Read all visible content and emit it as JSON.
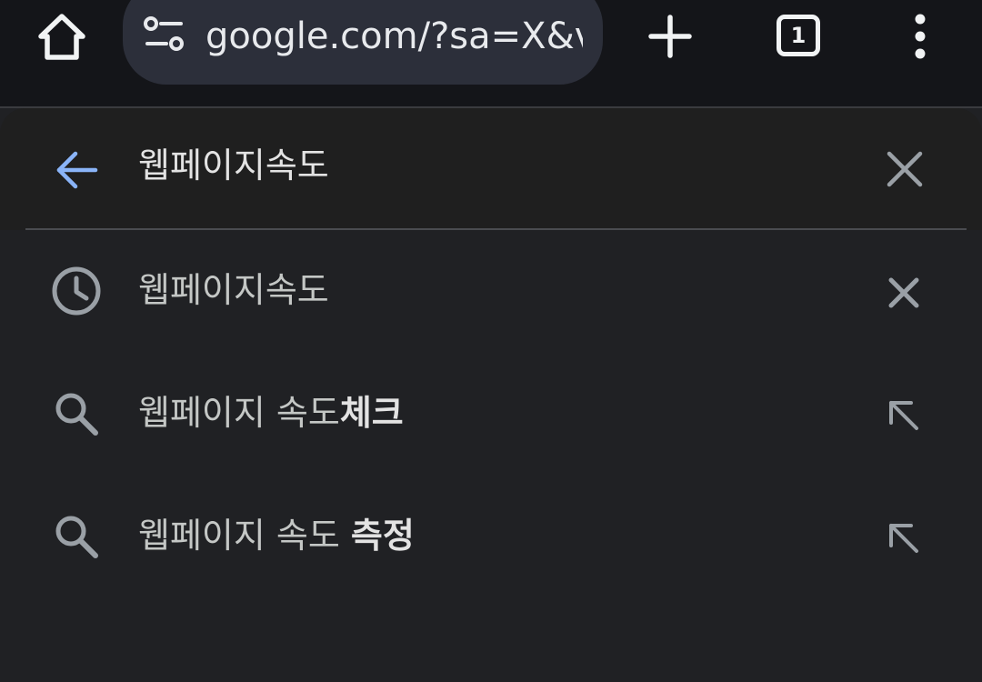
{
  "toolbar": {
    "url": "google.com/?sa=X&ved",
    "tab_count": "1",
    "icons": {
      "home": "home-icon",
      "site_settings": "tune-icon",
      "new_tab": "plus-icon",
      "tabs": "tab-switcher-icon",
      "menu": "more-vert-icon"
    }
  },
  "search": {
    "query": "웹페이지속도",
    "icons": {
      "back": "arrow-back-icon",
      "clear": "close-icon"
    }
  },
  "suggestions": [
    {
      "type": "history",
      "icon": "history-icon",
      "text_plain": "웹페이지속도",
      "text_bold": "",
      "action_icon": "close-icon"
    },
    {
      "type": "search",
      "icon": "search-icon",
      "text_plain": "웹페이지 속도",
      "text_bold": "체크",
      "action_icon": "arrow-up-left-icon"
    },
    {
      "type": "search",
      "icon": "search-icon",
      "text_plain": "웹페이지 속도 ",
      "text_bold": "측정",
      "action_icon": "arrow-up-left-icon"
    }
  ],
  "colors": {
    "toolbar_bg": "#141519",
    "omnibox_bg": "#2c2f3a",
    "panel_bg": "#202124",
    "search_bar_bg": "#1f1f1f",
    "accent_blue": "#8ab4f8",
    "icon_gray": "#9aa0a6",
    "text_primary": "#e3e3e3"
  }
}
